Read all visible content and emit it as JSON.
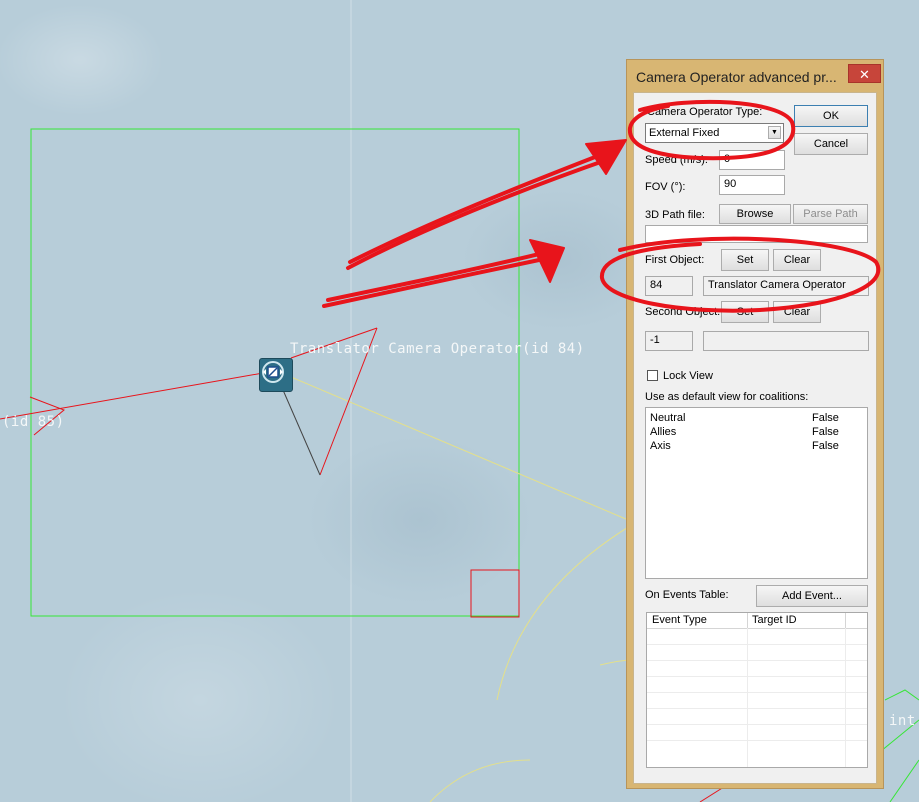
{
  "map": {
    "label_main": "Translator Camera Operator(id 84)",
    "label_left": "(id 85)",
    "label_right": "int"
  },
  "dialog": {
    "title": "Camera Operator advanced pr...",
    "close_label": "✕",
    "type_label": "Camera Operator Type:",
    "type_value": "External Fixed",
    "speed_label": "Speed (m/s):",
    "speed_value": "0",
    "fov_label": "FOV (°):",
    "fov_value": "90",
    "path_label": "3D Path file:",
    "browse_label": "Browse",
    "parse_path_label": "Parse Path",
    "path_value": "",
    "first_object_label": "First Object:",
    "first_set_label": "Set",
    "first_clear_label": "Clear",
    "first_object_id": "84",
    "first_object_name": "Translator Camera Operator",
    "second_object_label": "Second Object:",
    "second_set_label": "Set",
    "second_clear_label": "Clear",
    "second_object_id": "-1",
    "second_object_name": "",
    "ok_label": "OK",
    "cancel_label": "Cancel",
    "lock_view_label": "Lock View",
    "lock_view_checked": false,
    "coalitions_label": "Use as default view for coalitions:",
    "coalitions": [
      {
        "name": "Neutral",
        "value": "False"
      },
      {
        "name": "Allies",
        "value": "False"
      },
      {
        "name": "Axis",
        "value": "False"
      }
    ],
    "events_label": "On Events Table:",
    "add_event_label": "Add Event...",
    "events_columns": [
      "Event Type",
      "Target ID"
    ]
  },
  "colors": {
    "annotation_red": "#e8141b",
    "map_selection_green": "#36e636",
    "map_link_yellow": "#e4e08a",
    "dialog_frame": "#d8b673"
  },
  "icons": {
    "object_icon": "camera-operator-icon",
    "close_icon": "close-icon",
    "dropdown_icon": "chevron-down-icon"
  }
}
